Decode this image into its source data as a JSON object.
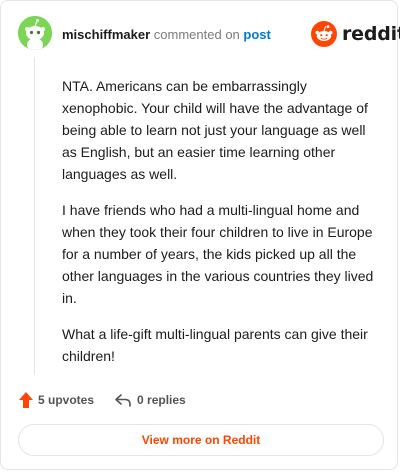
{
  "comment": {
    "author": "mischiffmaker",
    "action_text": "commented on",
    "post_link": "post",
    "paragraphs": [
      "NTA. Americans can be embarrassingly xenophobic. Your child will have the advantage of being able to learn not just your language as well as English, but an easier time learning other languages as well.",
      "I have friends who had a multi-lingual home and when they took their four children to live in Europe for a number of years, the kids picked up all the other languages in the various countries they lived in.",
      "What a life-gift multi-lingual parents can give their children!"
    ],
    "upvotes": "5 upvotes",
    "replies": "0 replies"
  },
  "brand": {
    "name": "reddit",
    "icon": "reddit-snoo-icon",
    "color": "#ff4500"
  },
  "avatar": {
    "icon": "snoo-avatar-icon",
    "color": "#7ad654"
  },
  "footer": {
    "view_more_label": "View more on Reddit"
  },
  "colors": {
    "link": "#0079d3",
    "upvote": "#ff4500",
    "text": "#1c1c1c",
    "muted": "#7c7c7c"
  }
}
